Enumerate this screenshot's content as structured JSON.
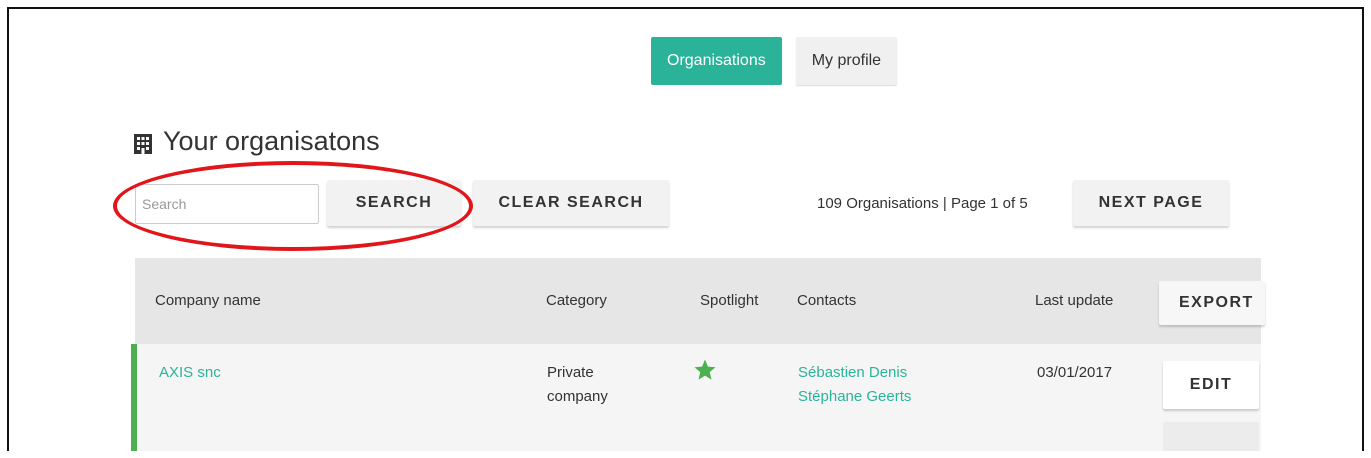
{
  "tabs": {
    "organisations": "Organisations",
    "my_profile": "My profile"
  },
  "page": {
    "title": "Your organisatons"
  },
  "search": {
    "placeholder": "Search",
    "search_label": "SEARCH",
    "clear_label": "CLEAR SEARCH"
  },
  "pagination": {
    "summary": "109 Organisations | Page 1 of 5",
    "next_label": "NEXT PAGE"
  },
  "table": {
    "columns": {
      "company": "Company name",
      "category": "Category",
      "spotlight": "Spotlight",
      "contacts": "Contacts",
      "last_update": "Last update"
    },
    "export_label": "EXPORT",
    "rows": [
      {
        "company": "AXIS snc",
        "category_line1": "Private",
        "category_line2": "company",
        "spotlight": true,
        "contacts": [
          "Sébastien Denis",
          "Stéphane Geerts"
        ],
        "last_update": "03/01/2017",
        "edit_label": "EDIT"
      }
    ]
  },
  "colors": {
    "accent": "#2bb39a",
    "row_marker": "#4caf50",
    "highlight": "#e0161a"
  },
  "icons": {
    "title": "building-icon",
    "spotlight": "star-icon"
  }
}
